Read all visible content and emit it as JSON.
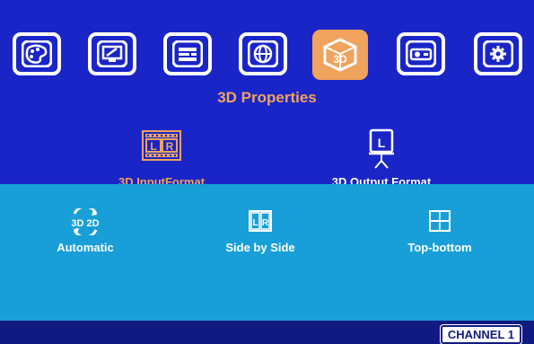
{
  "menu": {
    "tabs": [
      {
        "icon": "palette-icon",
        "active": false
      },
      {
        "icon": "display-settings-icon",
        "active": false
      },
      {
        "icon": "layout-bars-icon",
        "active": false
      },
      {
        "icon": "globe-icon",
        "active": false
      },
      {
        "icon": "3d-cube-icon",
        "label": "3D",
        "active": true
      },
      {
        "icon": "projector-icon",
        "active": false
      },
      {
        "icon": "gear-icon",
        "active": false
      }
    ],
    "title": "3D Properties"
  },
  "formats": {
    "input": {
      "label": "3D InputFormat",
      "icon": "lr-film-icon",
      "selected": true,
      "icon_text_l": "L",
      "icon_text_r": "R"
    },
    "output": {
      "label": "3D Output Format",
      "icon": "screen-projector-icon",
      "selected": false,
      "icon_text": "L"
    }
  },
  "options": {
    "items": [
      {
        "label": "Automatic",
        "icon": "3d-2d-auto-icon",
        "icon_text": "3D 2D"
      },
      {
        "label": "Side by Side",
        "icon": "side-by-side-icon",
        "icon_text_l": "L",
        "icon_text_r": "R"
      },
      {
        "label": "Top-bottom",
        "icon": "top-bottom-icon"
      }
    ]
  },
  "status": {
    "channel": "CHANNEL 1"
  },
  "colors": {
    "primary_bg": "#1a25c8",
    "accent": "#f0a35c",
    "panel": "#189fd8",
    "footer": "#101a80",
    "text": "#ffffff"
  }
}
